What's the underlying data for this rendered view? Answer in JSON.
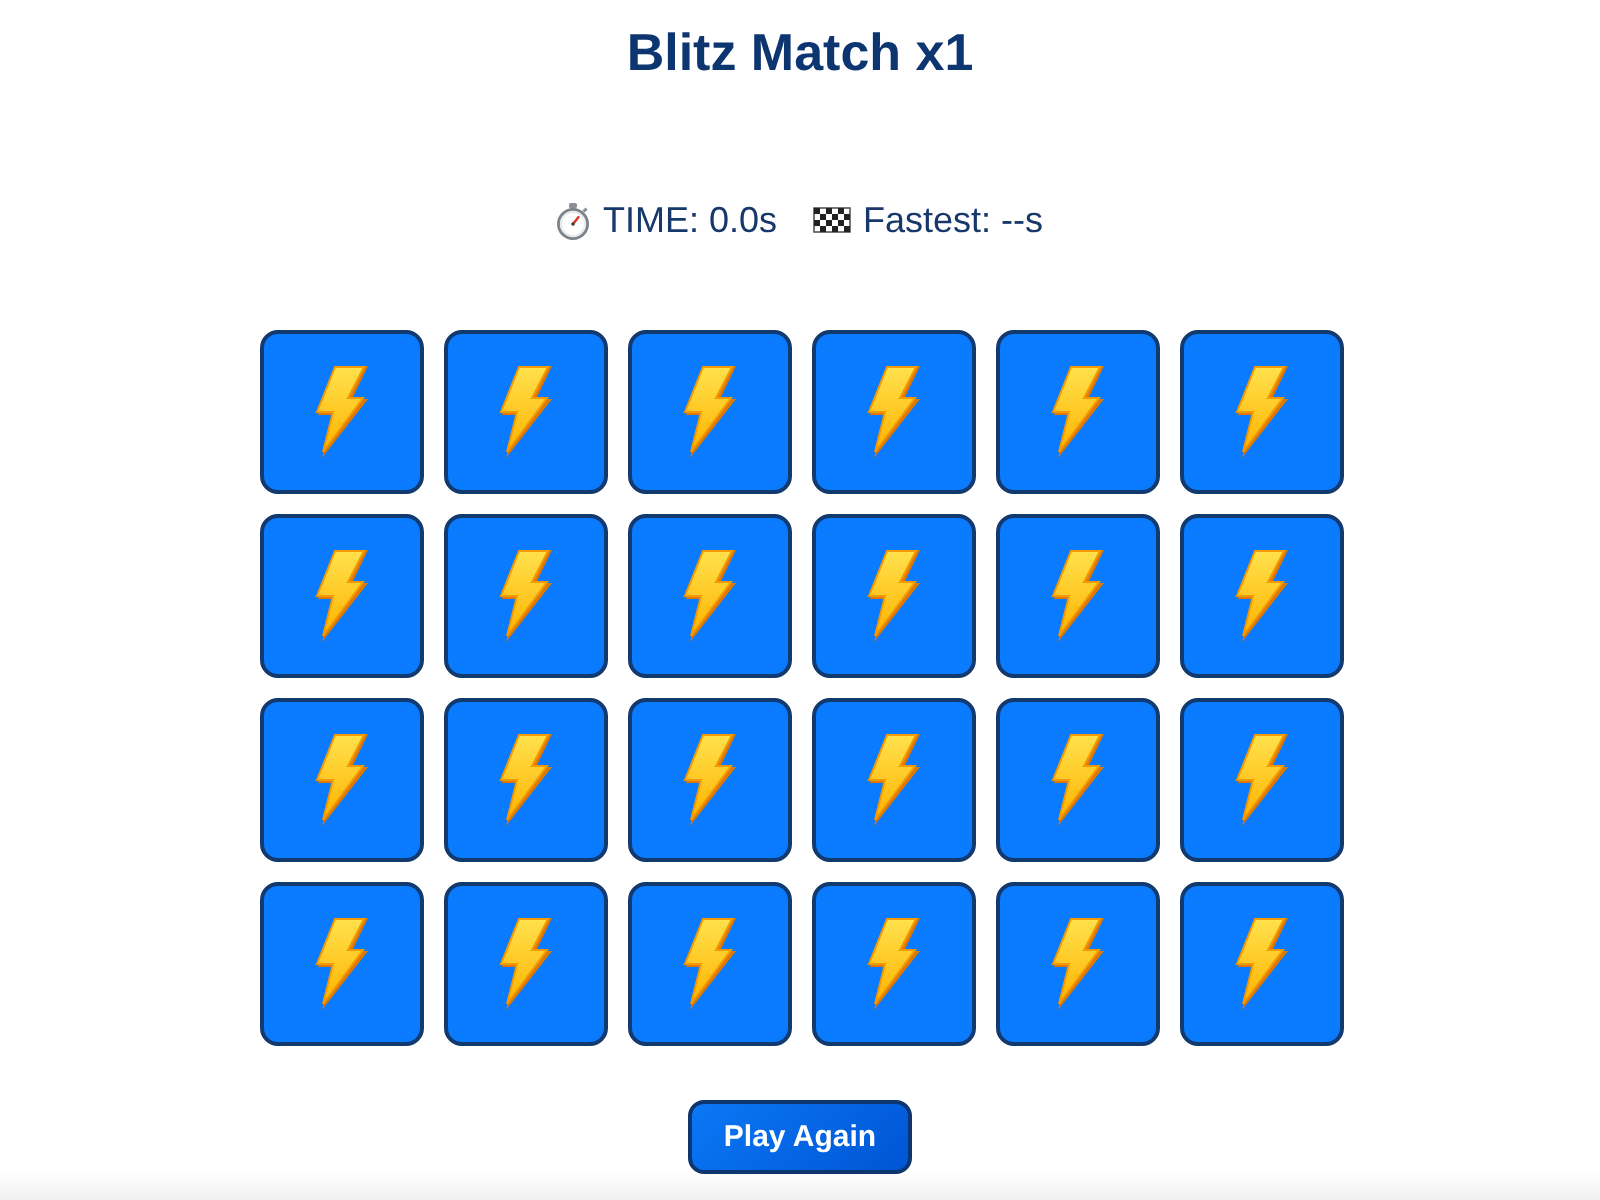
{
  "title": "Blitz Match x1",
  "stats": [
    {
      "kind": "timer",
      "text": "TIME: 0.0s"
    },
    {
      "kind": "best",
      "text": "Fastest: --s"
    }
  ],
  "cards": [
    {
      "face_up": false
    },
    {
      "face_up": false
    },
    {
      "face_up": false
    },
    {
      "face_up": false
    },
    {
      "face_up": false
    },
    {
      "face_up": false
    },
    {
      "face_up": false
    },
    {
      "face_up": false
    },
    {
      "face_up": false
    },
    {
      "face_up": false
    },
    {
      "face_up": false
    },
    {
      "face_up": false
    },
    {
      "face_up": false
    },
    {
      "face_up": false
    },
    {
      "face_up": false
    },
    {
      "face_up": false
    },
    {
      "face_up": false
    },
    {
      "face_up": false
    },
    {
      "face_up": false
    },
    {
      "face_up": false
    },
    {
      "face_up": false
    },
    {
      "face_up": false
    },
    {
      "face_up": false
    },
    {
      "face_up": false
    }
  ],
  "button": {
    "label": "Play Again"
  }
}
